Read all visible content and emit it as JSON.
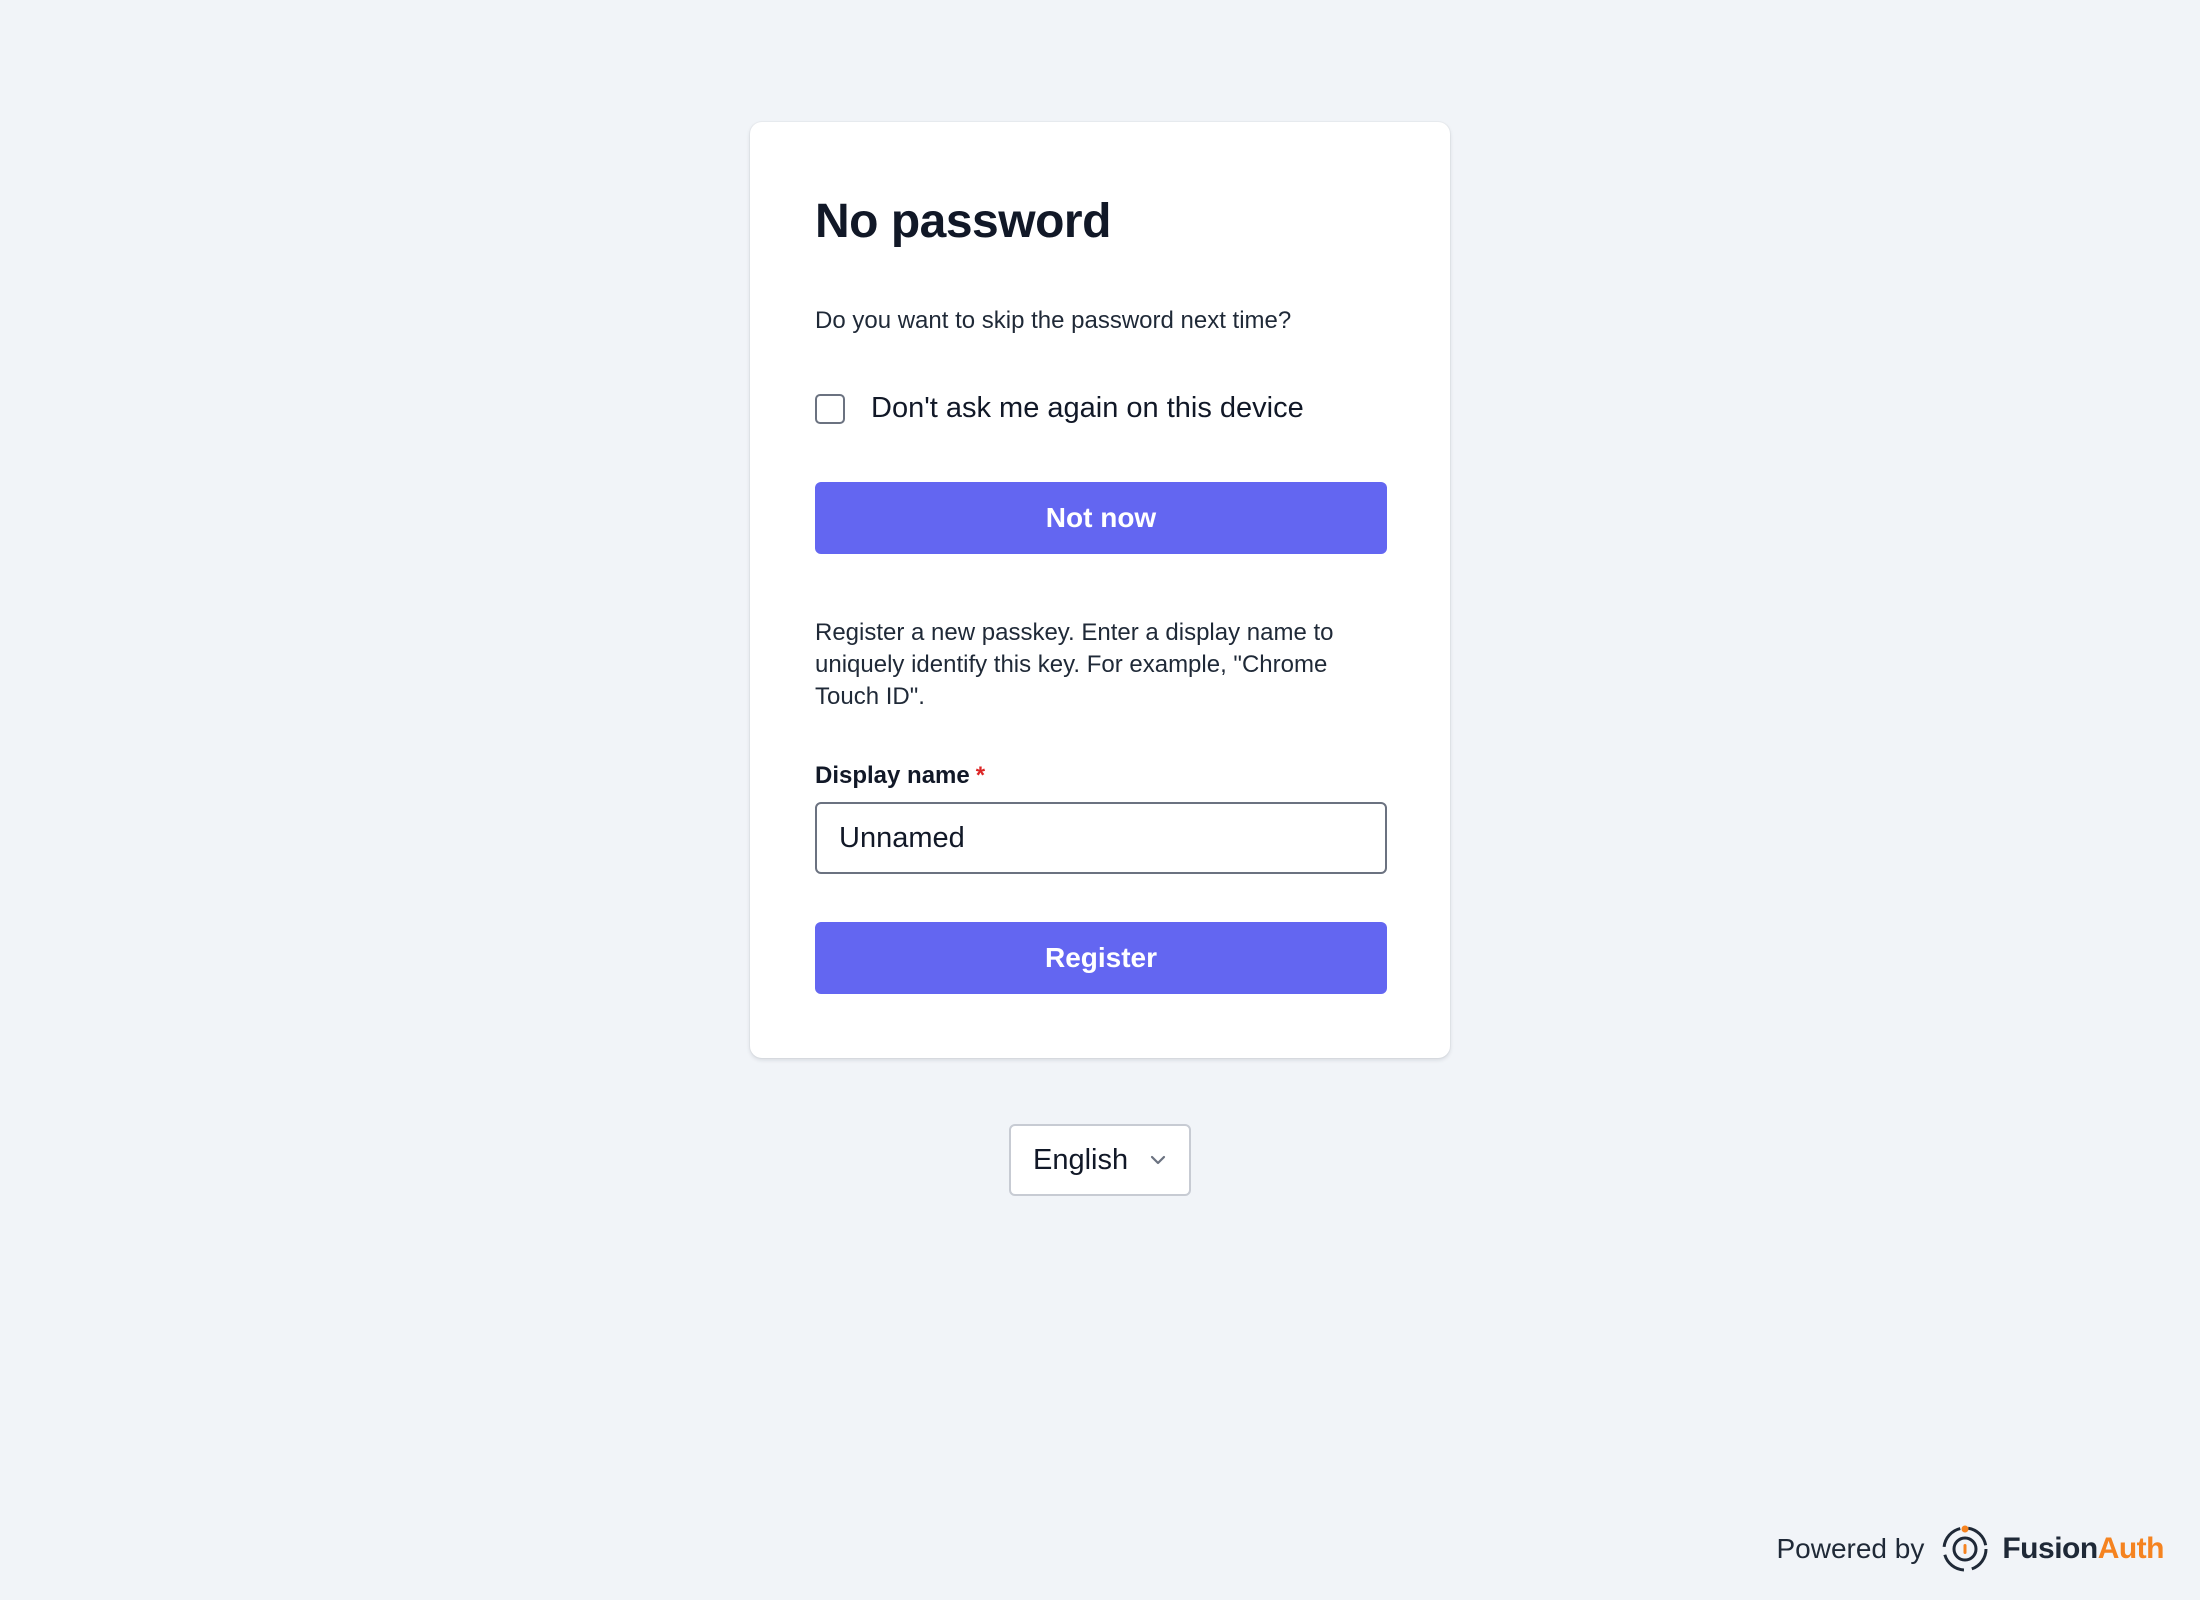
{
  "card": {
    "title": "No password",
    "question": "Do you want to skip the password next time?",
    "checkbox": {
      "label": "Don't ask me again on this device",
      "checked": false
    },
    "not_now_label": "Not now",
    "description": "Register a new passkey. Enter a display name to uniquely identify this key. For example, \"Chrome Touch ID\".",
    "display_name": {
      "label": "Display name",
      "required_marker": "*",
      "value": "Unnamed"
    },
    "register_label": "Register"
  },
  "language_select": {
    "selected": "English",
    "icon": "chevron-down-icon"
  },
  "footer": {
    "powered_by": "Powered by",
    "brand_fusion": "Fusion",
    "brand_auth": "Auth",
    "logo_icon": "fusionauth-logo-icon"
  },
  "colors": {
    "background": "#f1f4f8",
    "primary": "#6366f1",
    "required": "#dc2626",
    "brand_orange": "#f58320"
  }
}
